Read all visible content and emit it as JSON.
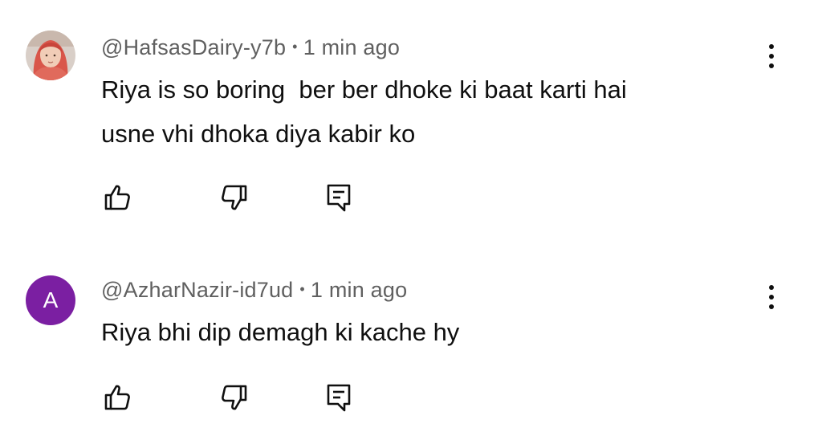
{
  "comments": [
    {
      "handle": "@HafsasDairy-y7b",
      "separator": "•",
      "time": "1 min ago",
      "text": "Riya is so boring  ber ber dhoke ki baat karti hai\nusne vhi dhoka diya kabir ko",
      "avatar_type": "photo"
    },
    {
      "handle": "@AzharNazir-id7ud",
      "separator": "•",
      "time": "1 min ago",
      "text": "Riya bhi dip demagh ki kache hy",
      "avatar_type": "letter",
      "avatar_letter": "A",
      "avatar_color": "#7b1fa2"
    }
  ],
  "icons": {
    "more": "more-vert-icon",
    "like": "thumbs-up-icon",
    "dislike": "thumbs-down-icon",
    "reply": "reply-comment-icon"
  }
}
